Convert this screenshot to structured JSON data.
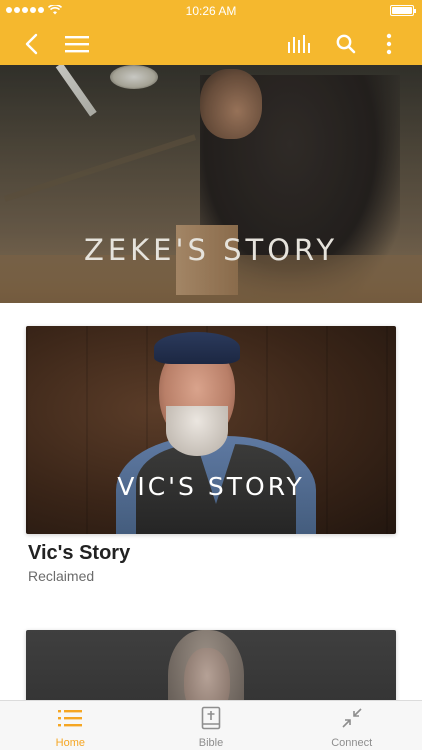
{
  "status_bar": {
    "time": "10:26 AM"
  },
  "app_bar": {
    "icons": [
      "back-icon",
      "menu-icon",
      "audio-icon",
      "search-icon",
      "more-icon"
    ],
    "color": "#f5b82e"
  },
  "hero": {
    "title": "ZEKE'S STORY"
  },
  "cards": [
    {
      "overlay_title": "VIC'S STORY",
      "title": "Vic's Story",
      "subtitle": "Reclaimed"
    }
  ],
  "tab_bar": {
    "tabs": [
      {
        "label": "Home",
        "icon": "list-icon",
        "active": true
      },
      {
        "label": "Bible",
        "icon": "bible-icon",
        "active": false
      },
      {
        "label": "Connect",
        "icon": "connect-icon",
        "active": false
      }
    ],
    "active_color": "#f5a623",
    "inactive_color": "#8e8e8e"
  }
}
